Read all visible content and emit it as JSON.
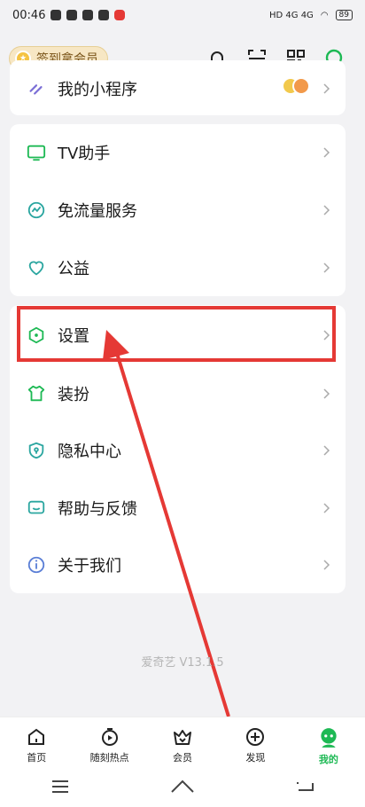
{
  "status_bar": {
    "time": "00:46",
    "battery": "89"
  },
  "header": {
    "vip_label": "签到拿会员"
  },
  "cards": [
    {
      "items": [
        {
          "label": "我的小程序",
          "icon": "mini-program-icon"
        }
      ]
    },
    {
      "items": [
        {
          "label": "TV助手",
          "icon": "tv-icon"
        },
        {
          "label": "免流量服务",
          "icon": "traffic-icon"
        },
        {
          "label": "公益",
          "icon": "charity-heart-icon"
        }
      ]
    },
    {
      "items": [
        {
          "label": "设置",
          "icon": "settings-icon"
        },
        {
          "label": "装扮",
          "icon": "shirt-icon"
        },
        {
          "label": "隐私中心",
          "icon": "privacy-shield-icon"
        },
        {
          "label": "帮助与反馈",
          "icon": "feedback-icon"
        },
        {
          "label": "关于我们",
          "icon": "info-icon"
        }
      ]
    }
  ],
  "version_text": "爱奇艺 V13.1.5",
  "tabs": [
    {
      "label": "首页",
      "icon": "home-icon"
    },
    {
      "label": "随刻热点",
      "icon": "hot-icon"
    },
    {
      "label": "会员",
      "icon": "vip-crown-icon"
    },
    {
      "label": "发现",
      "icon": "discover-plus-icon"
    },
    {
      "label": "我的",
      "icon": "profile-icon",
      "active": true
    }
  ],
  "colors": {
    "accent": "#1DB954",
    "highlight": "#E53935",
    "vip_bg": "#F7E7C4"
  }
}
